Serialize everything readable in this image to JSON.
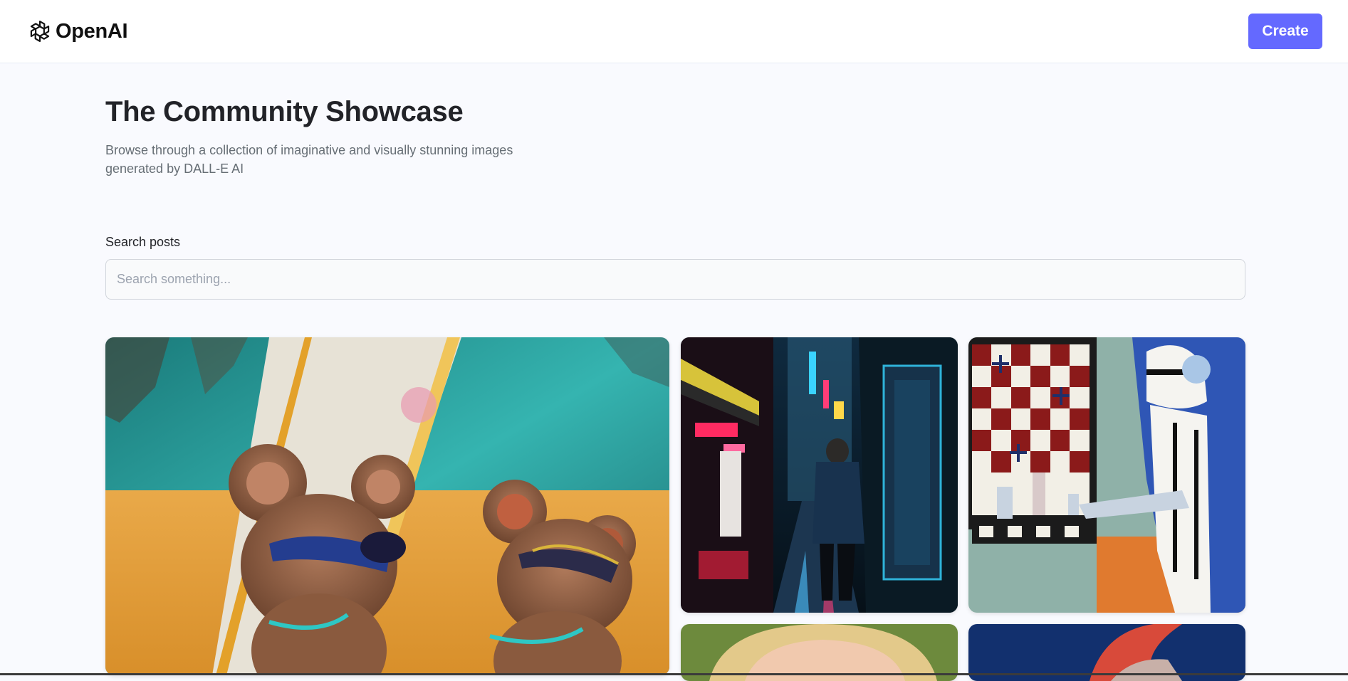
{
  "header": {
    "logo_text": "OpenAI",
    "logo_icon": "openai-logo-icon",
    "create_label": "Create",
    "accent_color": "#6469ff"
  },
  "hero": {
    "title": "The Community Showcase",
    "subtitle": "Browse through a collection of imaginative and visually stunning images generated by DALL-E AI"
  },
  "search": {
    "label": "Search posts",
    "placeholder": "Search something...",
    "value": ""
  },
  "gallery": {
    "cards": [
      {
        "name": "mice-surfers-beach-card"
      },
      {
        "name": "neon-alley-walker-card"
      },
      {
        "name": "robot-chess-painting-card"
      },
      {
        "name": "portrait-blonde-card"
      },
      {
        "name": "blue-abstract-card"
      }
    ]
  }
}
